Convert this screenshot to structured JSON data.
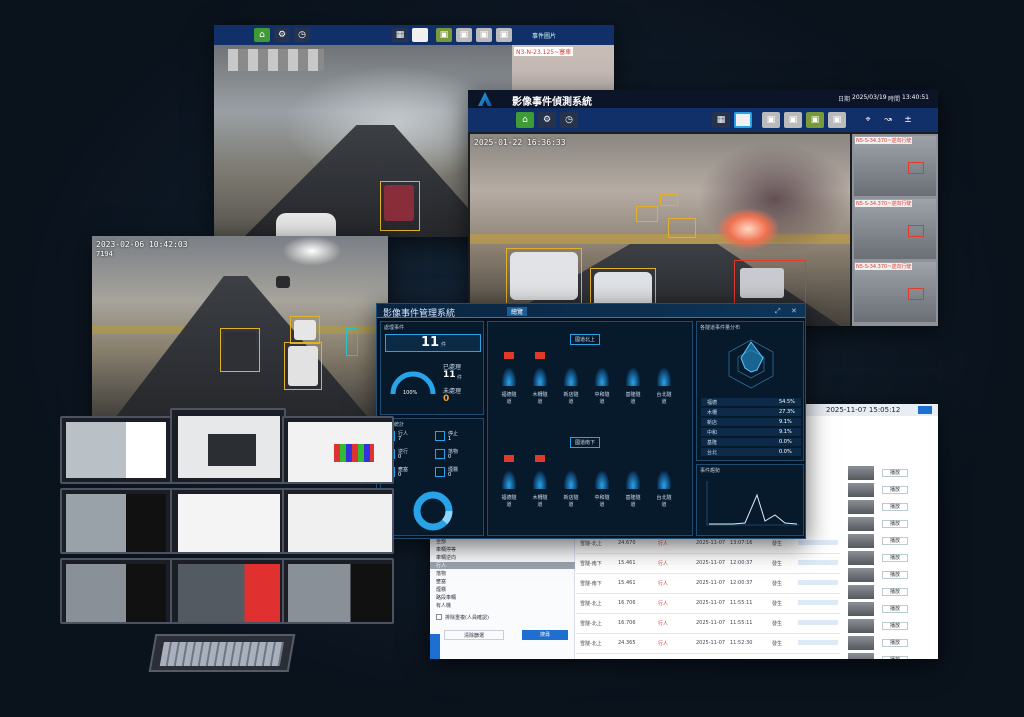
{
  "screen_a": {
    "event_panel_title": "事件圖片",
    "event_label": "N3-N-23.125~塞車"
  },
  "screen_b": {
    "title": "影像事件偵測系統",
    "date_label": "日期",
    "date_value": "2025/03/19",
    "time_label": "時間",
    "time_value": "13:40:51",
    "timestamp": "2025-01-22 16:36:33",
    "thumb_labels": [
      "N5-S-34.370~逆向行駛",
      "N5-S-34.370~逆向行駛",
      "N5-S-34.370~逆向行駛"
    ]
  },
  "screen_c": {
    "timestamp": "2023-02-06 10:42:03",
    "cam_id": "7194"
  },
  "screen_d": {
    "title": "影像事件管理系統",
    "tab": "總覽",
    "section_total": "處理事件",
    "total_value": "11",
    "total_unit": "件",
    "processed_label": "已處理",
    "processed_value": "11",
    "processed_unit": "件",
    "gauge_pct": "100%",
    "gauge_fraction": 1.0,
    "unprocessed_label": "未處理",
    "unprocessed_value": "0",
    "section_stats": "事件統計",
    "stat_items": [
      {
        "label": "行人",
        "value": "7"
      },
      {
        "label": "停止",
        "value": "1"
      },
      {
        "label": "逆行",
        "value": "0"
      },
      {
        "label": "落物",
        "value": "0"
      },
      {
        "label": "壅塞",
        "value": "0"
      },
      {
        "label": "煙霧",
        "value": "0"
      }
    ],
    "group1_title": "國道北上",
    "group2_title": "國道南下",
    "tunnels": [
      "福德隧道",
      "木柵隧道",
      "新店隧道",
      "中和隧道",
      "基隆隧道",
      "台北隧道"
    ],
    "radar_title": "各隧道事件量分布",
    "dist_rows": [
      {
        "name": "福德",
        "pct": "54.5%"
      },
      {
        "name": "木柵",
        "pct": "27.3%"
      },
      {
        "name": "新店",
        "pct": "9.1%"
      },
      {
        "name": "中和",
        "pct": "9.1%"
      },
      {
        "name": "基隆",
        "pct": "0.0%"
      },
      {
        "name": "台北",
        "pct": "0.0%"
      }
    ],
    "trend_title": "事件趨勢"
  },
  "screen_e": {
    "datetime": "2025-11-07 15:05:12",
    "sidebar_items": [
      "全部",
      "車輛停等",
      "車輛逆向",
      "行人",
      "落物",
      "壅塞",
      "煙霧",
      "路段車輛",
      "有人機"
    ],
    "checkbox_label": "排除重複(人員確認)",
    "clear_btn": "清除篩選",
    "search_btn": "搜尋",
    "rows": [
      {
        "loc": "雪隧-北上",
        "km": "24.670",
        "type": "行人",
        "date": "2025-11-07",
        "time": "13:07:16",
        "status": "發生"
      },
      {
        "loc": "雪隧-南下",
        "km": "15.461",
        "type": "行人",
        "date": "2025-11-07",
        "time": "12:00:37",
        "status": "發生"
      },
      {
        "loc": "雪隧-南下",
        "km": "15.461",
        "type": "行人",
        "date": "2025-11-07",
        "time": "12:00:37",
        "status": "發生"
      },
      {
        "loc": "雪隧-北上",
        "km": "16.706",
        "type": "行人",
        "date": "2025-11-07",
        "time": "11:55:11",
        "status": "發生"
      },
      {
        "loc": "雪隧-北上",
        "km": "16.706",
        "type": "行人",
        "date": "2025-11-07",
        "time": "11:55:11",
        "status": "發生"
      },
      {
        "loc": "雪隧-北上",
        "km": "24.365",
        "type": "行人",
        "date": "2025-11-07",
        "time": "11:52:30",
        "status": "發生"
      }
    ],
    "view_btn": "播放"
  },
  "colors": {
    "toolbar": "#11306a",
    "box": "#e3b02a",
    "alert": "#e13a2a",
    "accent": "#29a3e8"
  }
}
